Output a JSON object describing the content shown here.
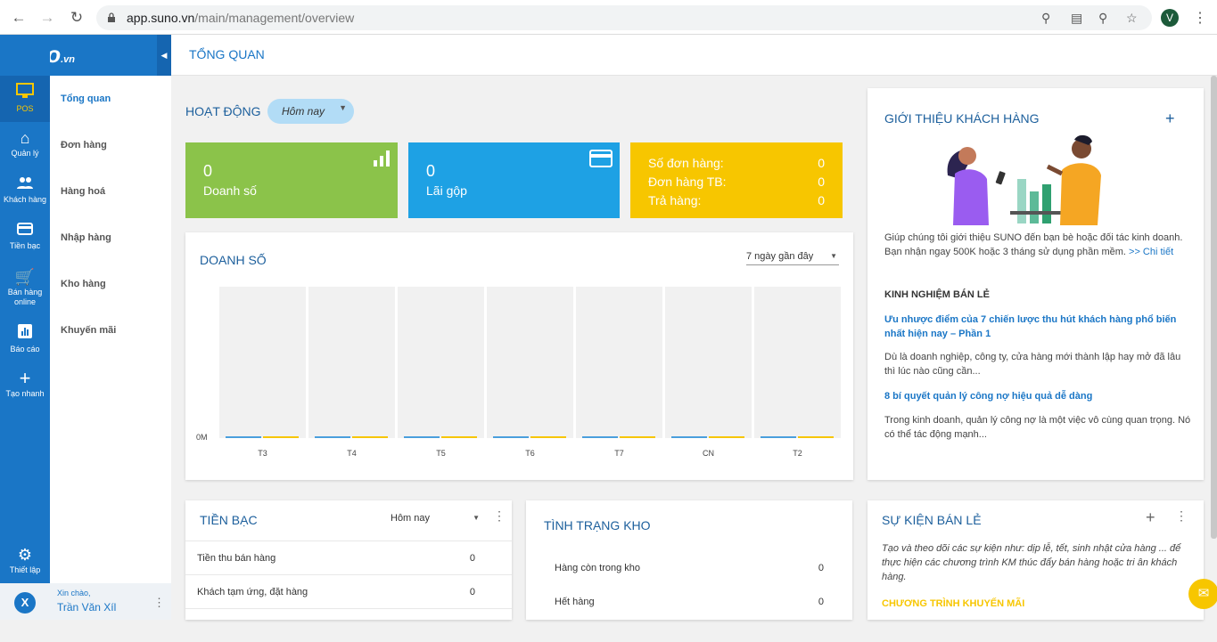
{
  "browser": {
    "url_domain": "app.suno.vn",
    "url_path": "/main/management/overview",
    "avatar_letter": "V"
  },
  "logo": {
    "main": "suno",
    "suffix": ".vn"
  },
  "sidebar": {
    "items": [
      {
        "label": "POS",
        "icon": "monitor-icon"
      },
      {
        "label": "Quản lý",
        "icon": "home-icon"
      },
      {
        "label": "Khách hàng",
        "icon": "people-icon"
      },
      {
        "label": "Tiền bạc",
        "icon": "card-icon"
      },
      {
        "label": "Bán hàng online",
        "icon": "cart-icon"
      },
      {
        "label": "Báo cáo",
        "icon": "report-icon"
      },
      {
        "label": "Tạo nhanh",
        "icon": "plus-icon"
      }
    ],
    "settings_label": "Thiết lập"
  },
  "subnav": {
    "items": [
      "Tổng quan",
      "Đơn hàng",
      "Hàng hoá",
      "Nhập hàng",
      "Kho hàng",
      "Khuyến mãi"
    ]
  },
  "user": {
    "greeting": "Xin chào,",
    "name": "Trần Văn Xíl"
  },
  "page_title": "TỔNG QUAN",
  "activity": {
    "title": "HOẠT ĐỘNG",
    "filter": "Hôm nay",
    "revenue": {
      "value": "0",
      "label": "Doanh số"
    },
    "profit": {
      "value": "0",
      "label": "Lãi gộp"
    },
    "orders": {
      "rows": [
        {
          "label": "Số đơn hàng:",
          "value": "0"
        },
        {
          "label": "Đơn hàng TB:",
          "value": "0"
        },
        {
          "label": "Trả hàng:",
          "value": "0"
        }
      ]
    }
  },
  "chart_data": {
    "type": "bar",
    "title": "DOANH SỐ",
    "range_filter": "7 ngày gần đây",
    "categories": [
      "T3",
      "T4",
      "T5",
      "T6",
      "T7",
      "CN",
      "T2"
    ],
    "series": [
      {
        "name": "",
        "values": [
          0,
          0,
          0,
          0,
          0,
          0,
          0
        ],
        "color": "#4a9fdc"
      },
      {
        "name": "",
        "values": [
          0,
          0,
          0,
          0,
          0,
          0,
          0
        ],
        "color": "#f7c600"
      }
    ],
    "y_tick_label": "0M",
    "ylim": [
      0,
      1
    ]
  },
  "intro": {
    "title": "GIỚI THIỆU KHÁCH HÀNG",
    "text": "Giúp chúng tôi giới thiệu SUNO đến bạn bè hoặc đối tác kinh doanh. Bạn nhận ngay 500K hoặc 3 tháng sử dụng phần mềm.",
    "link": ">> Chi tiết",
    "knowledge_title": "KINH NGHIỆM BÁN LẺ",
    "articles": [
      {
        "title": "Ưu nhược điểm của 7 chiến lược thu hút khách hàng phổ biến nhất hiện nay – Phần 1",
        "desc": "Dù là doanh nghiệp, công ty, cửa hàng mới thành lập hay mở đã lâu thì lúc nào cũng cần..."
      },
      {
        "title": "8 bí quyết quản lý công nợ hiệu quả dễ dàng",
        "desc": "Trong kinh doanh, quản lý công nợ là một việc vô cùng quan trọng. Nó có thể tác động mạnh..."
      }
    ]
  },
  "money": {
    "title": "TIỀN BẠC",
    "filter": "Hôm nay",
    "rows": [
      {
        "label": "Tiền thu bán hàng",
        "value": "0"
      },
      {
        "label": "Khách tạm ứng, đặt hàng",
        "value": "0"
      }
    ]
  },
  "stock": {
    "title": "TÌNH TRẠNG KHO",
    "rows": [
      {
        "label": "Hàng còn trong kho",
        "value": "0"
      },
      {
        "label": "Hết hàng",
        "value": "0"
      }
    ]
  },
  "events": {
    "title": "SỰ KIỆN BÁN LẺ",
    "text": "Tạo và theo dõi các sự kiện như: dịp lễ, tết, sinh nhật cửa hàng ... để thực hiện các chương trình KM thúc đẩy bán hàng hoặc tri ân khách hàng.",
    "promo_title": "CHƯƠNG TRÌNH KHUYẾN MÃI"
  },
  "colors": {
    "brand": "#1a76c6",
    "green": "#8bc34a",
    "blue": "#1ea1e4",
    "yellow": "#f7c600"
  }
}
